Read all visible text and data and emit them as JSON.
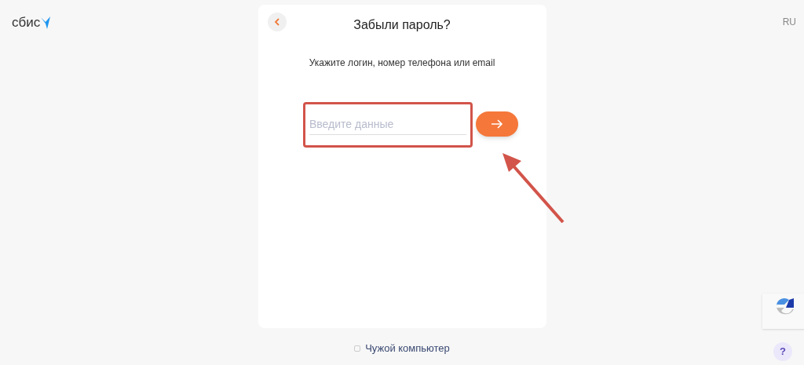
{
  "logo": {
    "text": "сбис"
  },
  "language": "RU",
  "card": {
    "title": "Забыли пароль?",
    "instruction": "Укажите логин, номер телефона или email",
    "field": {
      "placeholder": "Введите данные"
    }
  },
  "checkbox": {
    "label": "Чужой компьютер",
    "checked": false
  },
  "help": "?"
}
